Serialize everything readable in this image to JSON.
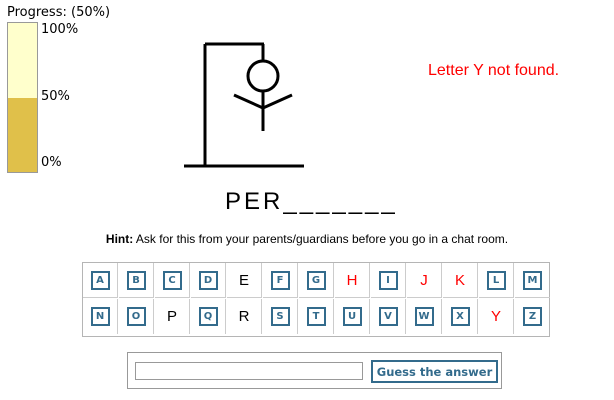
{
  "progress": {
    "label": "Progress: (50%)",
    "value": 0.5,
    "ticks": [
      "100%",
      "50%",
      "0%"
    ],
    "fill_color": "#e0c04a",
    "track_color": "#ffffcc"
  },
  "message": {
    "text": "Letter Y not found.",
    "color": "#ff0000"
  },
  "word": {
    "display": "PER_______"
  },
  "hint": {
    "label": "Hint:",
    "text": "Ask for this from your parents/guardians before you go in a chat room."
  },
  "keyboard": {
    "rows": [
      [
        {
          "letter": "A",
          "state": "available"
        },
        {
          "letter": "B",
          "state": "available"
        },
        {
          "letter": "C",
          "state": "available"
        },
        {
          "letter": "D",
          "state": "available"
        },
        {
          "letter": "E",
          "state": "hit"
        },
        {
          "letter": "F",
          "state": "available"
        },
        {
          "letter": "G",
          "state": "available"
        },
        {
          "letter": "H",
          "state": "miss"
        },
        {
          "letter": "I",
          "state": "available"
        },
        {
          "letter": "J",
          "state": "miss"
        },
        {
          "letter": "K",
          "state": "miss"
        },
        {
          "letter": "L",
          "state": "available"
        },
        {
          "letter": "M",
          "state": "available"
        }
      ],
      [
        {
          "letter": "N",
          "state": "available"
        },
        {
          "letter": "O",
          "state": "available"
        },
        {
          "letter": "P",
          "state": "hit"
        },
        {
          "letter": "Q",
          "state": "available"
        },
        {
          "letter": "R",
          "state": "hit"
        },
        {
          "letter": "S",
          "state": "available"
        },
        {
          "letter": "T",
          "state": "available"
        },
        {
          "letter": "U",
          "state": "available"
        },
        {
          "letter": "V",
          "state": "available"
        },
        {
          "letter": "W",
          "state": "available"
        },
        {
          "letter": "X",
          "state": "available"
        },
        {
          "letter": "Y",
          "state": "miss"
        },
        {
          "letter": "Z",
          "state": "available"
        }
      ]
    ]
  },
  "guess": {
    "input_value": "",
    "button_label": "Guess the answer"
  },
  "colors": {
    "key_border": "#336b8c",
    "miss": "#ff0000"
  }
}
